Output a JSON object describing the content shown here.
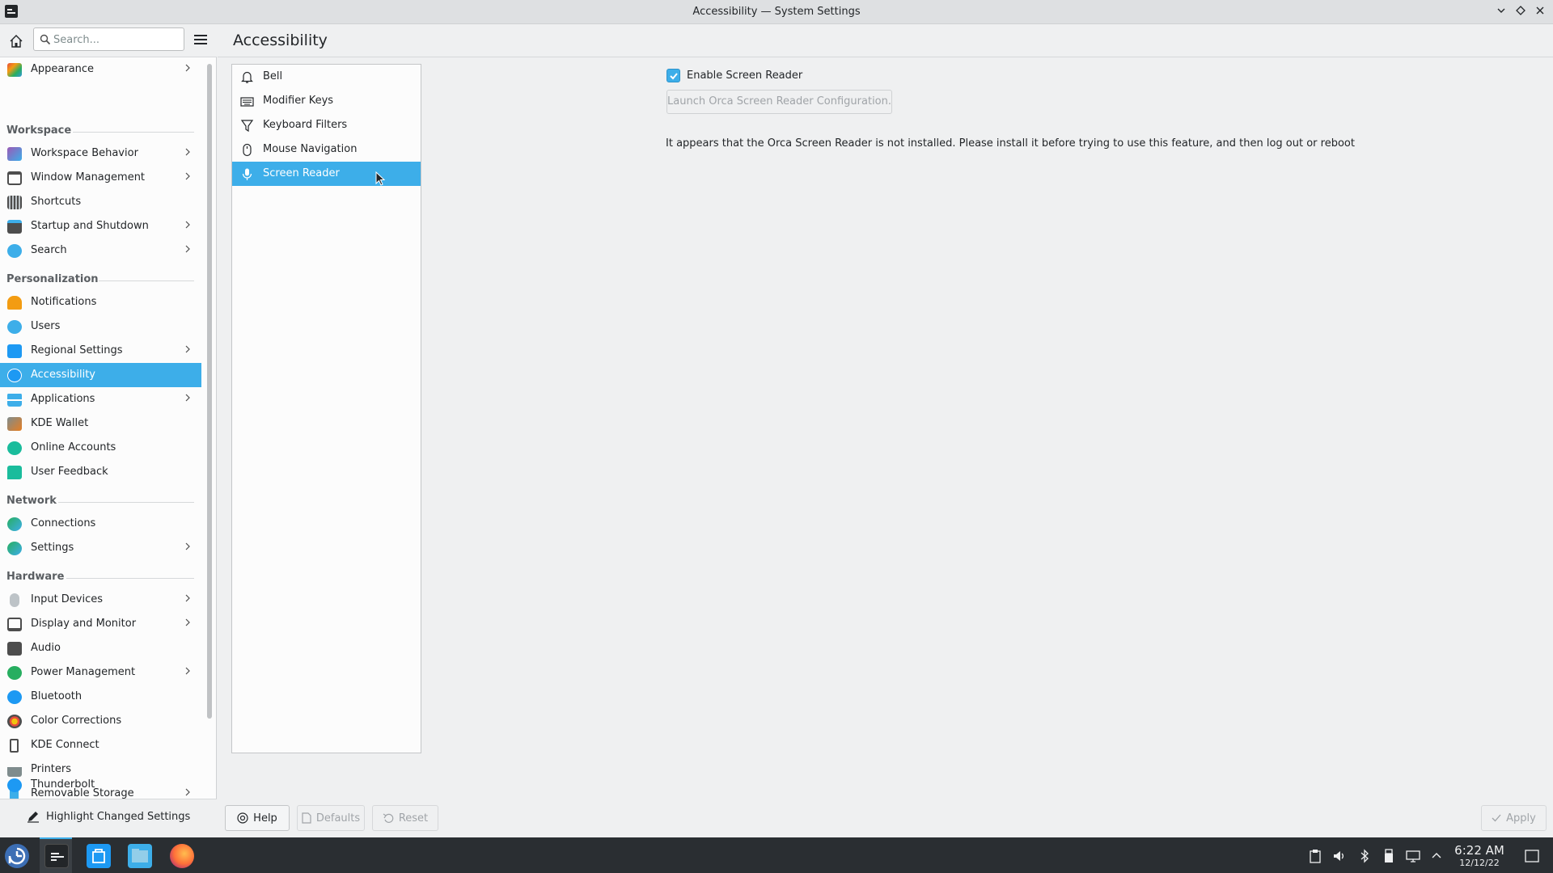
{
  "window": {
    "title": "Accessibility — System Settings"
  },
  "search": {
    "placeholder": "Search..."
  },
  "sidebar": {
    "top_item": {
      "label": "Appearance"
    },
    "categories": {
      "workspace": "Workspace",
      "personalization": "Personalization",
      "network": "Network",
      "hardware": "Hardware"
    },
    "workspace_items": [
      {
        "label": "Workspace Behavior"
      },
      {
        "label": "Window Management"
      },
      {
        "label": "Shortcuts"
      },
      {
        "label": "Startup and Shutdown"
      },
      {
        "label": "Search"
      }
    ],
    "personalization_items": [
      {
        "label": "Notifications"
      },
      {
        "label": "Users"
      },
      {
        "label": "Regional Settings"
      },
      {
        "label": "Accessibility"
      },
      {
        "label": "Applications"
      },
      {
        "label": "KDE Wallet"
      },
      {
        "label": "Online Accounts"
      },
      {
        "label": "User Feedback"
      }
    ],
    "network_items": [
      {
        "label": "Connections"
      },
      {
        "label": "Settings"
      }
    ],
    "hardware_items": [
      {
        "label": "Input Devices"
      },
      {
        "label": "Display and Monitor"
      },
      {
        "label": "Audio"
      },
      {
        "label": "Power Management"
      },
      {
        "label": "Bluetooth"
      },
      {
        "label": "Color Corrections"
      },
      {
        "label": "KDE Connect"
      },
      {
        "label": "Printers"
      },
      {
        "label": "Removable Storage"
      },
      {
        "label": "Thunderbolt"
      }
    ],
    "highlight_label": "Highlight Changed Settings"
  },
  "main": {
    "title": "Accessibility",
    "subpages": [
      {
        "label": "Bell",
        "icon": "bell-icon"
      },
      {
        "label": "Modifier Keys",
        "icon": "keyboard-icon"
      },
      {
        "label": "Keyboard Filters",
        "icon": "filter-icon"
      },
      {
        "label": "Mouse Navigation",
        "icon": "mouse-icon"
      },
      {
        "label": "Screen Reader",
        "icon": "microphone-icon"
      }
    ],
    "selected_subpage": "Screen Reader",
    "enable_screen_reader": {
      "label": "Enable Screen Reader",
      "checked": true
    },
    "launch_button": "Launch Orca Screen Reader Configuration...",
    "message": "It appears that the Orca Screen Reader is not installed. Please install it before trying to use this feature, and then log out or reboot"
  },
  "footer": {
    "help": "Help",
    "defaults": "Defaults",
    "reset": "Reset",
    "apply": "Apply"
  },
  "taskbar": {
    "time": "6:22 AM",
    "date": "12/12/22"
  },
  "colors": {
    "accent": "#3daee9",
    "panel": "#2a2e32",
    "window_bg": "#eff0f1"
  }
}
